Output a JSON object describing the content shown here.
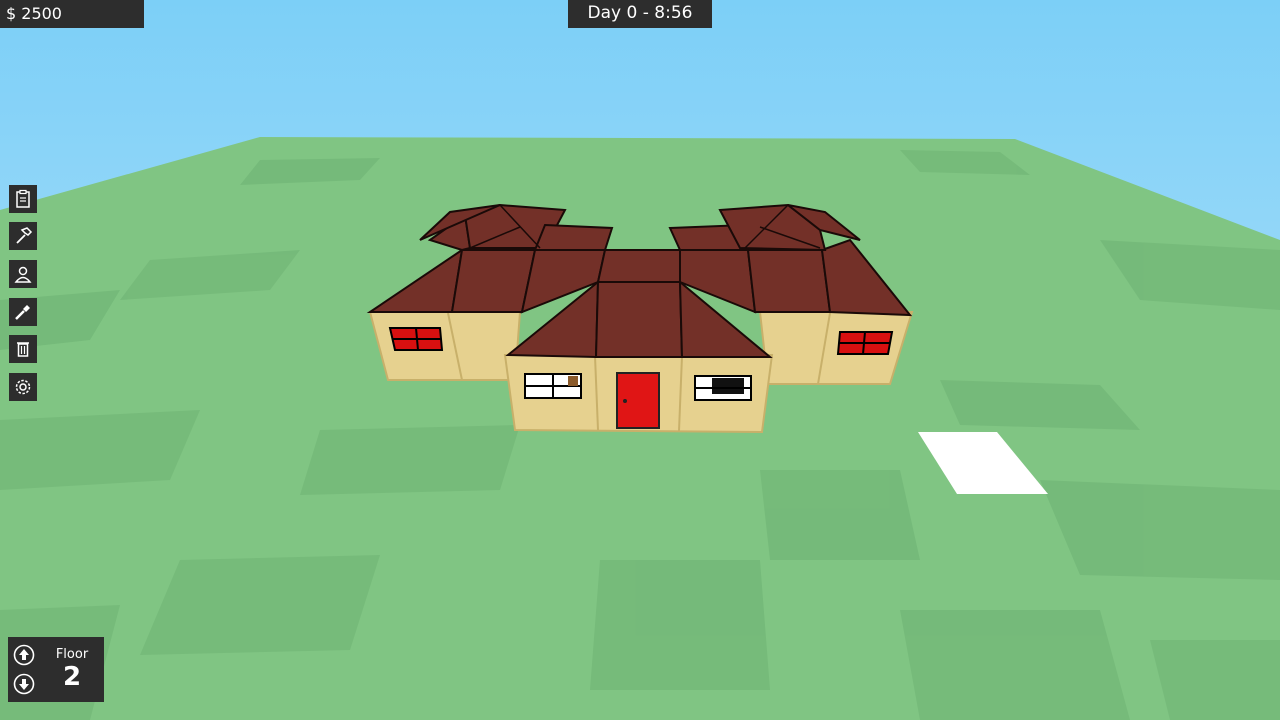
{
  "hud": {
    "money": "$ 2500",
    "clock": "Day 0 - 8:56"
  },
  "toolbar": {
    "items": [
      {
        "name": "clipboard-icon"
      },
      {
        "name": "hammer-icon"
      },
      {
        "name": "person-icon"
      },
      {
        "name": "paint-icon"
      },
      {
        "name": "trash-icon"
      },
      {
        "name": "gear-icon"
      }
    ]
  },
  "floor_panel": {
    "label": "Floor",
    "value": "2",
    "up_icon": "arrow-up-circle-icon",
    "down_icon": "arrow-down-circle-icon"
  },
  "colors": {
    "sky": "#7ccff7",
    "grass": "#7ec582",
    "roof": "#733028",
    "wall": "#e6d18f",
    "door": "#e01515",
    "hud_bg": "#2d2d2d"
  }
}
